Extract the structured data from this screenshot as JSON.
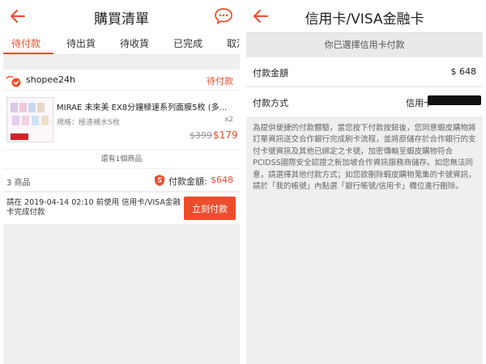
{
  "left": {
    "title": "購買清單",
    "icons": {
      "back": "back-arrow-icon",
      "chat": "chat-icon"
    },
    "tabs": [
      "待付款",
      "待出貨",
      "待收貨",
      "已完成",
      "取消"
    ],
    "active_tab": "待付款",
    "shop": {
      "name": "shopee24h",
      "status": "待付款"
    },
    "product": {
      "name": "MIRAE 未來美 EX8分鐘極速系列面膜5枚 (多...",
      "spec": "規格：極速補水5枚",
      "qty": "x2",
      "old_price": "$399",
      "new_price": "$179"
    },
    "more_items": "還有1個商品",
    "summary": {
      "count": "3 商品",
      "label": "付款金額:",
      "value": "$648"
    },
    "payment_note": "請在 2019-04-14 02:10 前使用 信用卡/VISA金融卡完成付款",
    "pay_button": "立刻付款"
  },
  "right": {
    "title": "信用卡/VISA金融卡",
    "icons": {
      "back": "back-arrow-icon"
    },
    "notice": "你已選擇信用卡付款",
    "amount_label": "付款金額",
    "amount_value": "$ 648",
    "method_label": "付款方式",
    "method_value": "信用卡",
    "description": "為提供便捷的付款體驗，當您按下付款按鈕後，您同意蝦皮購物將訂單資訊送交合作銀行完成刷卡流程，並將原儲存於合作銀行的支付卡號資訊及其他已綁定之卡號，加密傳輸至蝦皮購物符合PCIDSS國際安全認證之新加坡合作資訊服務商儲存。如您無法同意，請選擇其他付款方式；如您欲刪除蝦皮購物蒐集的卡號資訊，請於「我的帳號」內點選「銀行帳號/信用卡」欄位進行刪除。"
  },
  "colors": {
    "accent": "#ee4d2d",
    "background": "#efefef"
  }
}
